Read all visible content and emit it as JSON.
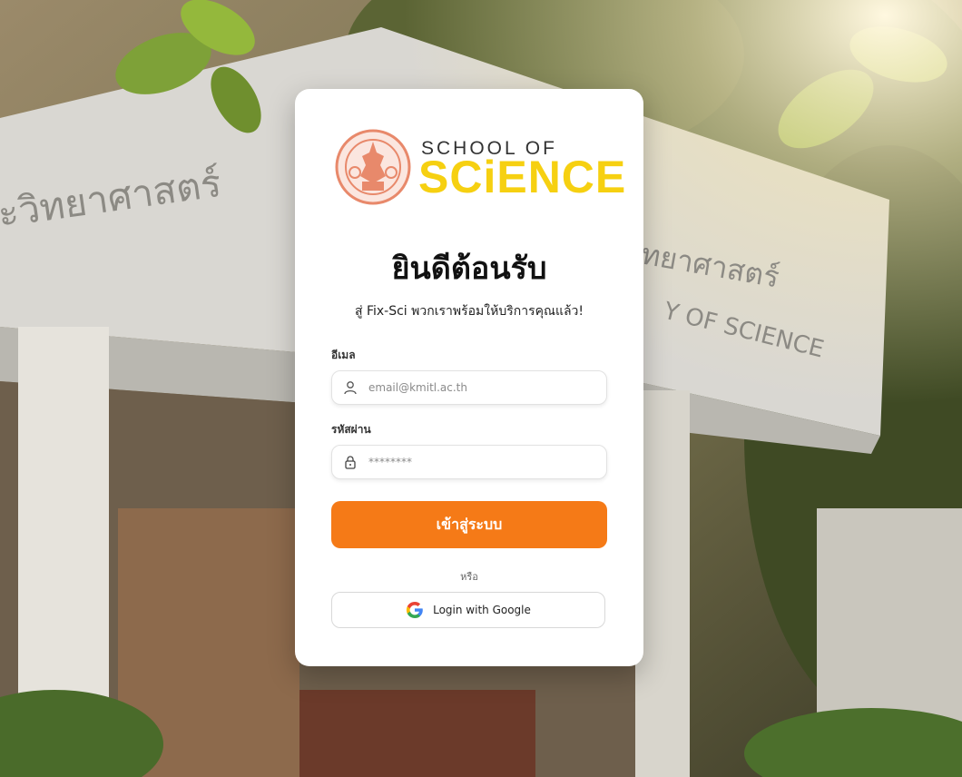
{
  "colors": {
    "accent": "#f57a17",
    "logo_yellow": "#f6d011",
    "seal_orange": "#e8896b"
  },
  "logo": {
    "line1": "SCHOOL OF",
    "line2": "SCiENCE"
  },
  "header": {
    "title": "ยินดีต้อนรับ",
    "subtitle": "สู่ Fix-Sci พวกเราพร้อมให้บริการคุณแล้ว!"
  },
  "form": {
    "email_label": "อีเมล",
    "email_placeholder": "email@kmitl.ac.th",
    "email_icon": "user-icon",
    "password_label": "รหัสผ่าน",
    "password_placeholder": "********",
    "password_icon": "lock-icon",
    "submit_label": "เข้าสู่ระบบ",
    "or_text": "หรือ",
    "google_label": "Login with Google"
  }
}
